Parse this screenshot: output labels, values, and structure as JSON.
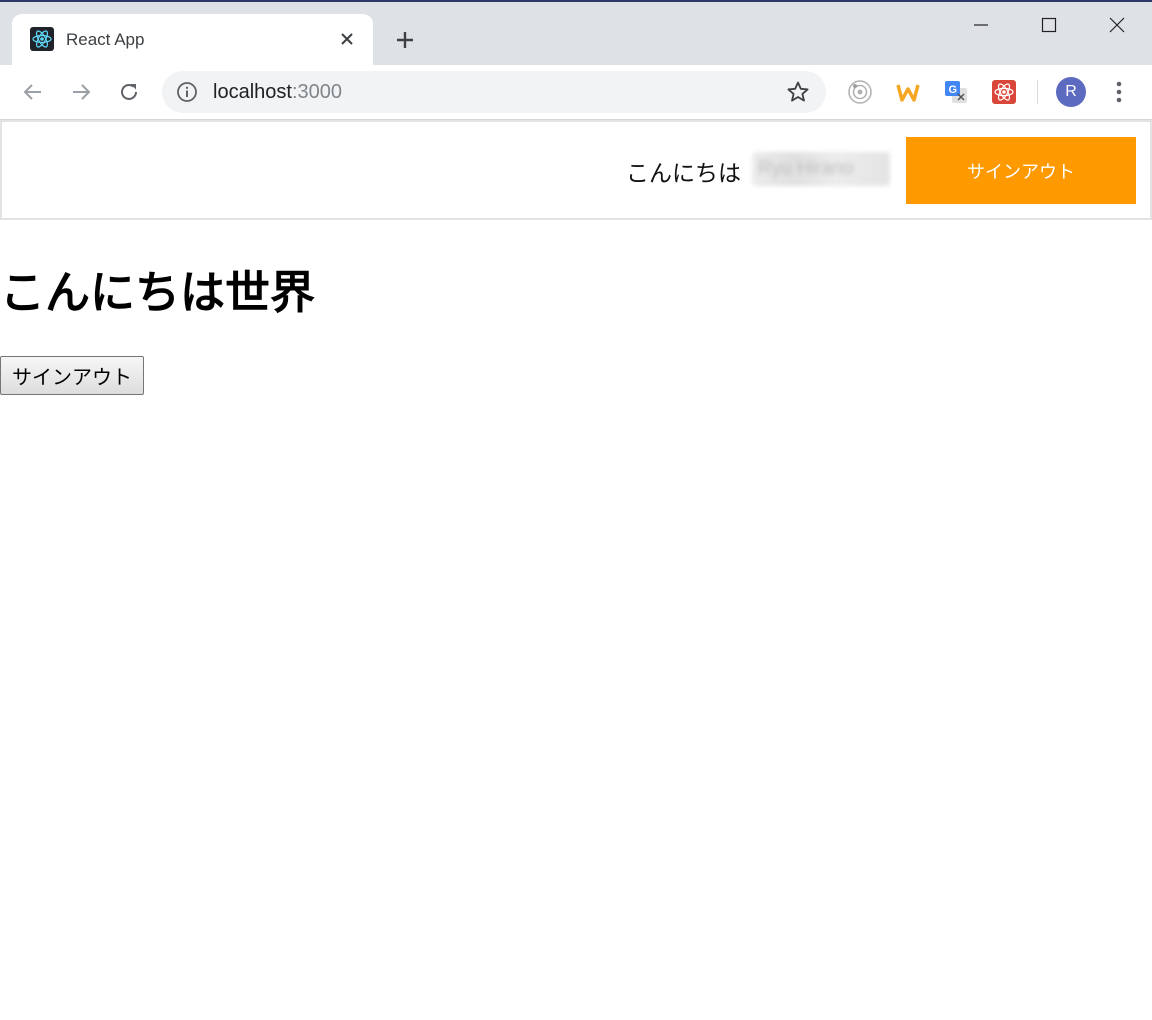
{
  "browser": {
    "tab_title": "React App",
    "url_host": "localhost",
    "url_port": ":3000",
    "avatar_initial": "R",
    "accent_color": "#2b3a67"
  },
  "header": {
    "greeting": "こんにちは",
    "username": "Ryu Hirano",
    "signout_label": "サインアウト",
    "signout_color": "#ff9900"
  },
  "main": {
    "heading": "こんにちは世界",
    "signout_label": "サインアウト"
  }
}
